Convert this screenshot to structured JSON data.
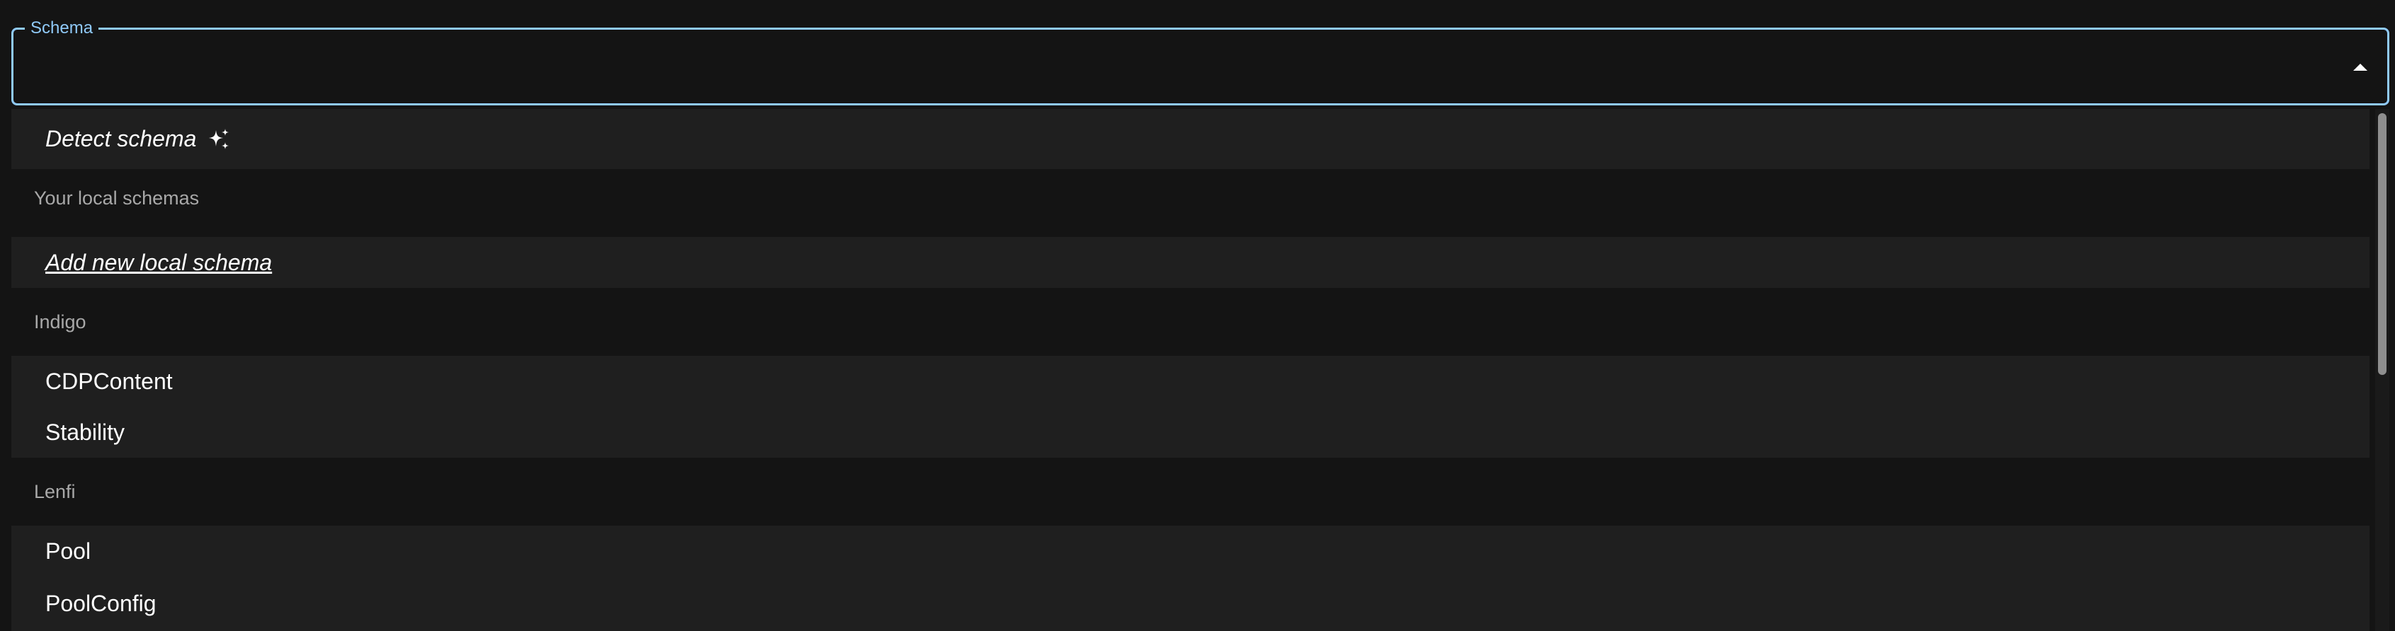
{
  "field": {
    "label": "Schema",
    "value": ""
  },
  "menu": {
    "detect": {
      "label": "Detect schema",
      "icon": "sparkles-icon"
    },
    "local_group": "Your local schemas",
    "add_local": "Add new local schema",
    "groups": [
      {
        "label": "Indigo",
        "items": [
          "CDPContent",
          "Stability"
        ]
      },
      {
        "label": "Lenfi",
        "items": [
          "Pool",
          "PoolConfig"
        ]
      }
    ]
  },
  "colors": {
    "accent": "#90caf9",
    "background": "#141414",
    "option_bg": "#1f1f1f",
    "group_text": "#a8a8a8"
  }
}
